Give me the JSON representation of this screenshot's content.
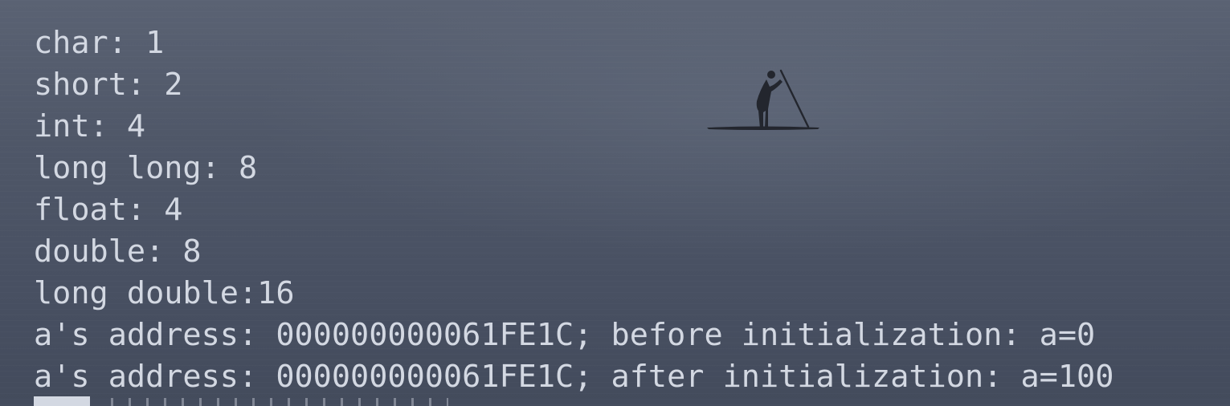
{
  "terminal": {
    "lines": [
      "char: 1",
      "short: 2",
      "int: 4",
      "long long: 8",
      "float: 4",
      "double: 8",
      "long double:16",
      "a's address: 000000000061FE1C; before initialization: a=0",
      "a's address: 000000000061FE1C; after initialization: a=100"
    ]
  },
  "colors": {
    "text": "#d3d8e2",
    "background": "#4b5364"
  },
  "wallpaper": {
    "subject": "paddleboarder-silhouette"
  }
}
